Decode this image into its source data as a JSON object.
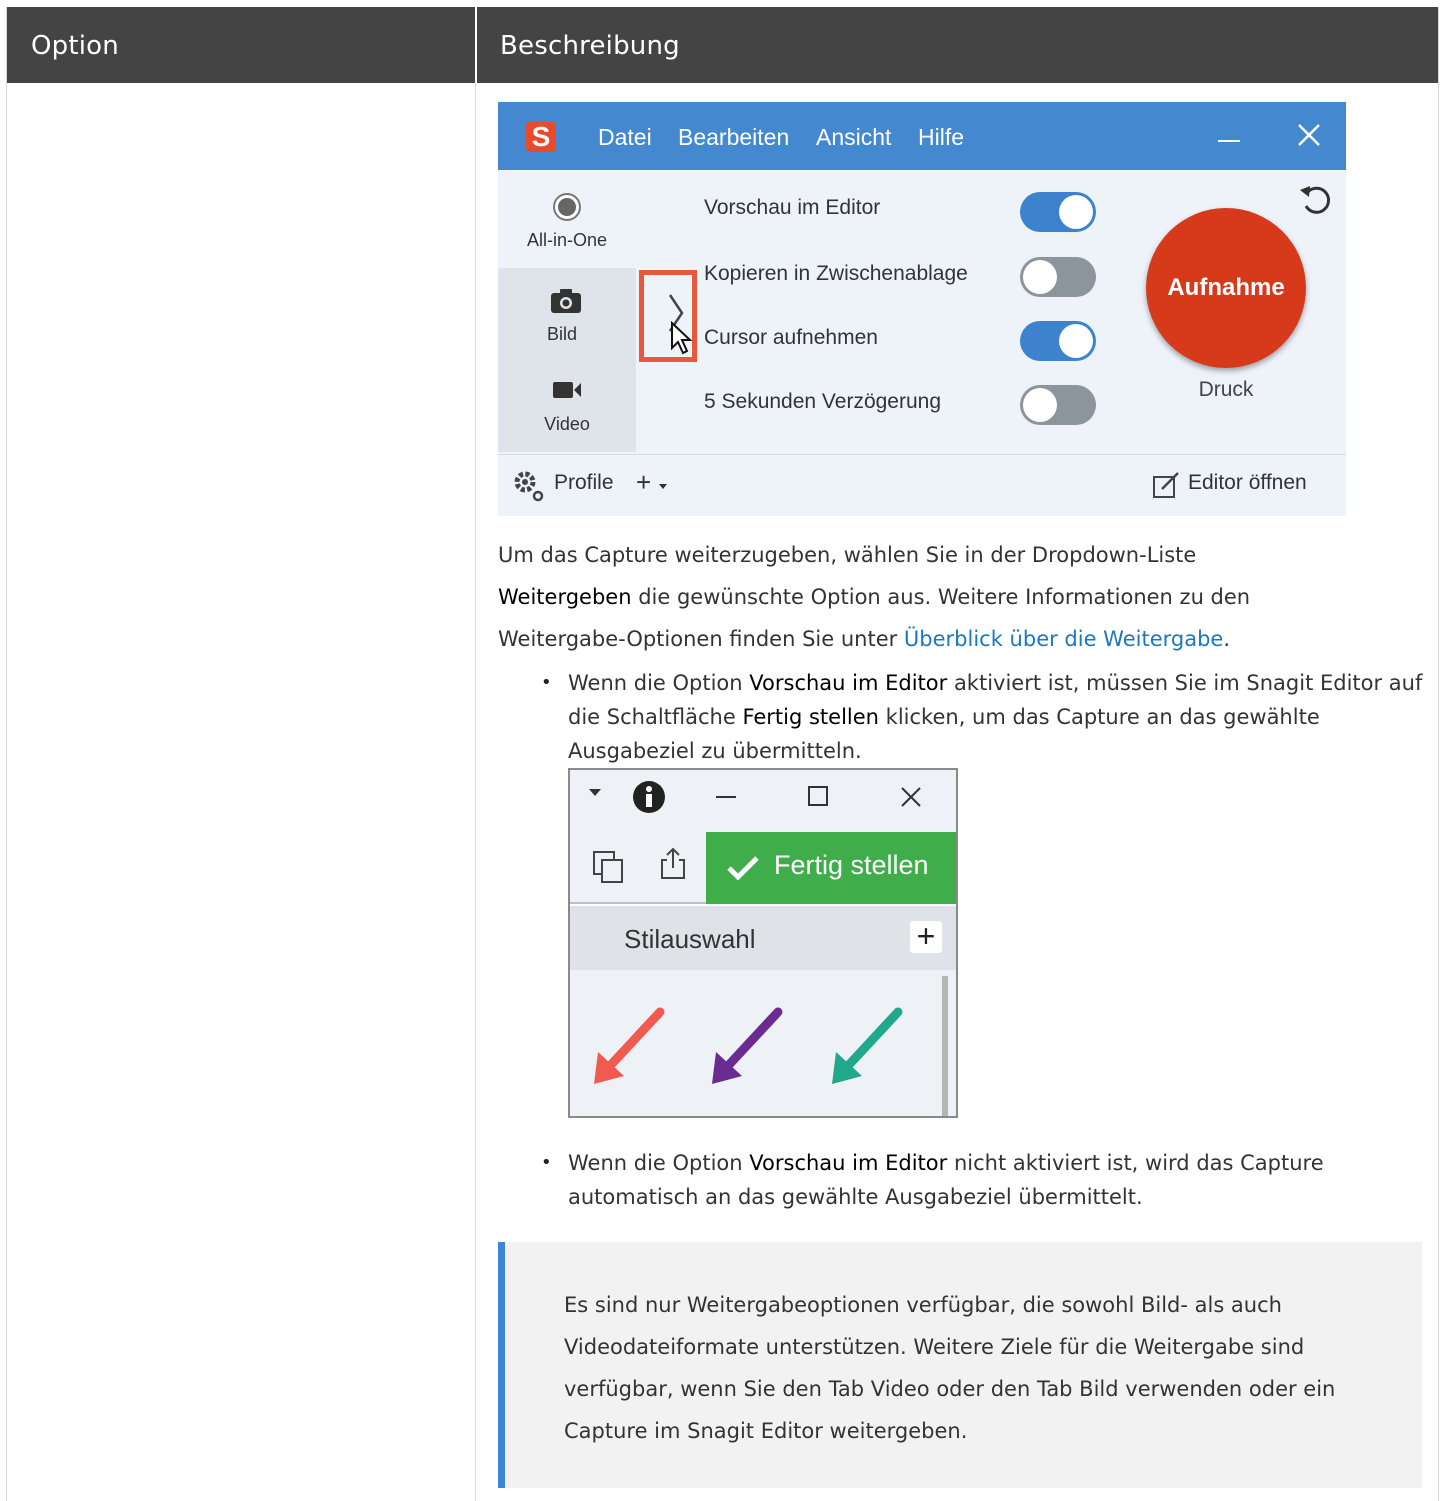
{
  "table": {
    "header_option": "Option",
    "header_description": "Beschreibung"
  },
  "capture_window": {
    "logo": "S",
    "menu": [
      "Datei",
      "Bearbeiten",
      "Ansicht",
      "Hilfe"
    ],
    "tabs": {
      "all_in_one": "All-in-One",
      "image": "Bild",
      "video": "Video"
    },
    "options": [
      {
        "label": "Vorschau im Editor",
        "on": true
      },
      {
        "label": "Kopieren in Zwischenablage",
        "on": false
      },
      {
        "label": "Cursor aufnehmen",
        "on": true
      },
      {
        "label": "5 Sekunden Verzögerung",
        "on": false
      }
    ],
    "capture_button": "Aufnahme",
    "hotkey": "Druck",
    "profile_label": "Profile",
    "add_label": "+",
    "open_editor": "Editor öffnen",
    "accent_color": "#4489d0",
    "capture_color": "#d63a1a"
  },
  "text": {
    "p1_a": "Um das Capture weiterzugeben, wählen Sie in der Dropdown-Liste",
    "p1_bold": "Weitergeben",
    "p1_b": " die gewünschte Option aus. Weitere Informationen zu den",
    "p1_c": "Weitergabe-Optionen finden Sie unter ",
    "p1_link": "Überblick über die Weitergabe",
    "p1_end": ".",
    "b1_a": "Wenn die Option ",
    "b1_bold1": "Vorschau im Editor",
    "b1_b": " aktiviert ist, müssen Sie im Snagit Editor auf die Schaltfläche ",
    "b1_bold2": "Fertig stellen",
    "b1_c": " klicken, um das Capture an das gewählte Ausgabeziel zu übermitteln.",
    "b2_a": "Wenn die Option ",
    "b2_bold": "Vorschau im Editor",
    "b2_b": " nicht aktiviert ist, wird das Capture automatisch an das gewählte Ausgabeziel übermittelt."
  },
  "editor_window": {
    "done_button": "Fertig stellen",
    "style_header": "Stilauswahl",
    "plus": "+",
    "done_color": "#3fad4a",
    "arrow_colors": [
      "#f05a4f",
      "#6a2c91",
      "#1fa88a"
    ]
  },
  "note": {
    "text": "Es sind nur Weitergabeoptionen verfügbar, die sowohl Bild- als auch Videodateiformate unterstützen. Weitere Ziele für die Weitergabe sind verfügbar, wenn Sie den Tab Video oder den Tab Bild verwenden oder ein Capture im Snagit Editor weitergeben."
  }
}
